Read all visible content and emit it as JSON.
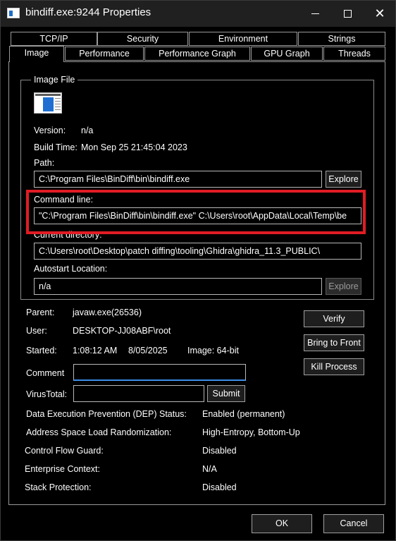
{
  "window": {
    "title": "bindiff.exe:9244 Properties",
    "close_glyph": "✕"
  },
  "tabs": {
    "row1": [
      "TCP/IP",
      "Security",
      "Environment",
      "Strings"
    ],
    "row2": [
      "Image",
      "Performance",
      "Performance Graph",
      "GPU Graph",
      "Threads"
    ],
    "active": "Image"
  },
  "image_file": {
    "legend": "Image File",
    "icon": "executable-file-icon",
    "version_label": "Version:",
    "version_value": "n/a",
    "build_time_label": "Build Time:",
    "build_time_value": "Mon Sep 25 21:45:04 2023",
    "path_label": "Path:",
    "path_value": "C:\\Program Files\\BinDiff\\bin\\bindiff.exe",
    "explore_label": "Explore",
    "command_line_label": "Command line:",
    "command_line_value": "\"C:\\Program Files\\BinDiff\\bin\\bindiff.exe\" C:\\Users\\root\\AppData\\Local\\Temp\\be",
    "current_dir_label": "Current directory:",
    "current_dir_value": "C:\\Users\\root\\Desktop\\patch diffing\\tooling\\Ghidra\\ghidra_11.3_PUBLIC\\",
    "autostart_label": "Autostart Location:",
    "autostart_value": "n/a",
    "autostart_explore_label": "Explore"
  },
  "process": {
    "parent_label": "Parent:",
    "parent_value": "javaw.exe(26536)",
    "user_label": "User:",
    "user_value": "DESKTOP-JJ08ABF\\root",
    "started_label": "Started:",
    "started_time": "1:08:12 AM",
    "started_date": "8/05/2025",
    "image_label": "Image: 64-bit",
    "verify_label": "Verify",
    "bring_to_front_label": "Bring to Front",
    "kill_process_label": "Kill Process",
    "comment_label": "Comment",
    "comment_value": "",
    "virustotal_label": "VirusTotal:",
    "virustotal_value": "",
    "submit_label": "Submit"
  },
  "security_info": [
    {
      "label": "Data Execution Prevention (DEP) Status:",
      "value": "Enabled (permanent)"
    },
    {
      "label": "Address Space Load Randomization:",
      "value": "High-Entropy, Bottom-Up"
    },
    {
      "label": "Control Flow Guard:",
      "value": "Disabled"
    },
    {
      "label": "Enterprise Context:",
      "value": "N/A"
    },
    {
      "label": "Stack Protection:",
      "value": "Disabled"
    }
  ],
  "footer": {
    "ok_label": "OK",
    "cancel_label": "Cancel"
  },
  "colors": {
    "highlight": "#e01c24",
    "input_accent": "#3b8ee8"
  }
}
